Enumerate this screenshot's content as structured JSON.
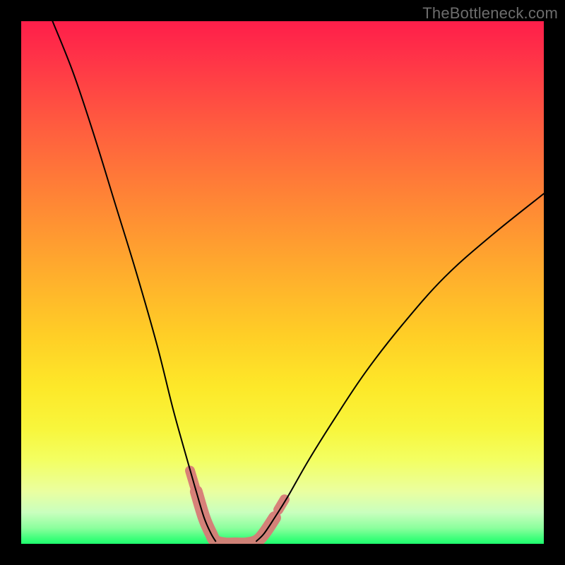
{
  "watermark": "TheBottleneck.com",
  "chart_data": {
    "type": "line",
    "title": "",
    "xlabel": "",
    "ylabel": "",
    "xlim": [
      0,
      100
    ],
    "ylim": [
      0,
      100
    ],
    "grid": false,
    "background_gradient": {
      "top_color": "#ff1e4a",
      "mid_color": "#ffd22a",
      "bottom_color": "#1fff6e"
    },
    "series": [
      {
        "name": "left-curve",
        "x": [
          6,
          10,
          14,
          18,
          22,
          26,
          29,
          31.5,
          33.5,
          35,
          36.3,
          37.2
        ],
        "y": [
          100,
          90,
          78,
          65,
          52,
          38,
          26,
          17,
          10,
          5,
          2,
          0.5
        ]
      },
      {
        "name": "right-curve",
        "x": [
          45.0,
          46.5,
          48.5,
          51,
          55,
          60,
          66,
          73,
          81,
          90,
          100
        ],
        "y": [
          0.5,
          2,
          5,
          9,
          16,
          24,
          33,
          42,
          51,
          59,
          67
        ]
      }
    ],
    "highlight_region": {
      "name": "bottleneck-marker",
      "color": "#d77a76",
      "points_x": [
        33.5,
        35,
        36.3,
        37.2,
        39,
        41,
        43,
        45,
        46.5,
        48.5
      ],
      "points_y": [
        10,
        5,
        2,
        0.5,
        0,
        0,
        0,
        0.5,
        2,
        5
      ]
    },
    "left_side_markers": {
      "x": [
        32.3,
        33.2
      ],
      "y": [
        14,
        11
      ]
    },
    "right_side_markers": {
      "x": [
        49.2,
        50.4
      ],
      "y": [
        6.5,
        8.5
      ]
    }
  }
}
